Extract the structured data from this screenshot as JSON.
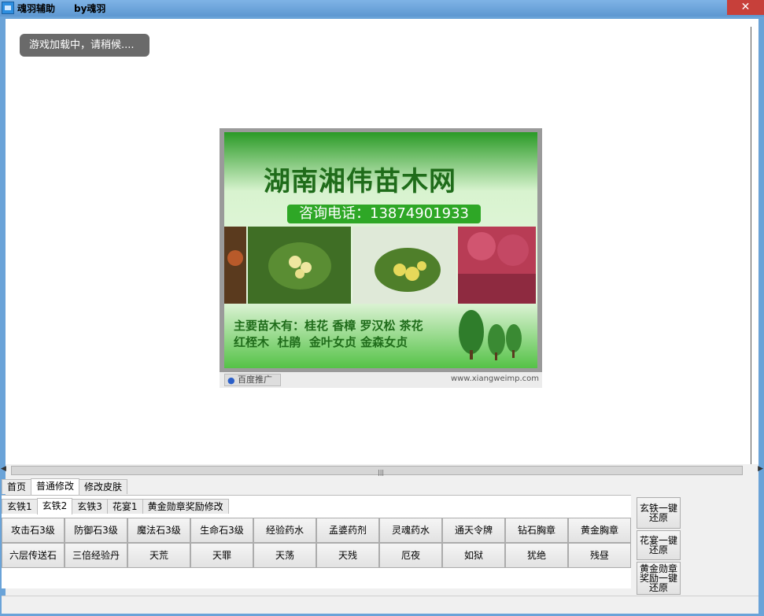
{
  "window": {
    "app_title": "魂羽辅助",
    "author": "by魂羽",
    "close_glyph": "✕"
  },
  "browser": {
    "loading_text": "游戏加载中，请稍候....",
    "ad": {
      "title": "湖南湘伟苗木网",
      "phone": "咨询电话：13874901933",
      "description": "主要苗木有：桂花 香樟 罗汉松 茶花\n红桎木  杜鹃  金叶女贞 金森女贞",
      "badge": "百度推广",
      "url": "www.xiangweimp.com"
    }
  },
  "tabs": [
    "首页",
    "普通修改",
    "修改皮肤"
  ],
  "subtabs": [
    "玄铁1",
    "玄铁2",
    "玄铁3",
    "花宴1",
    "黄金勋章奖励修改"
  ],
  "buttons_row1": [
    "攻击石3级",
    "防御石3级",
    "魔法石3级",
    "生命石3级",
    "经验药水",
    "孟婆药剂",
    "灵魂药水",
    "通天令牌",
    "钻石胸章",
    "黄金胸章"
  ],
  "buttons_row2": [
    "六层传送石",
    "三倍经验丹",
    "天荒",
    "天罪",
    "天荡",
    "天残",
    "厄夜",
    "如狱",
    "犹绝",
    "残昼"
  ],
  "side_buttons": [
    "玄铁一键还原",
    "花宴一键还原",
    "黄金勋章奖励一键还原"
  ],
  "colors": {
    "titlebar": "#6aa3d8",
    "close": "#c7403a",
    "ad_green": "#2ea726"
  }
}
